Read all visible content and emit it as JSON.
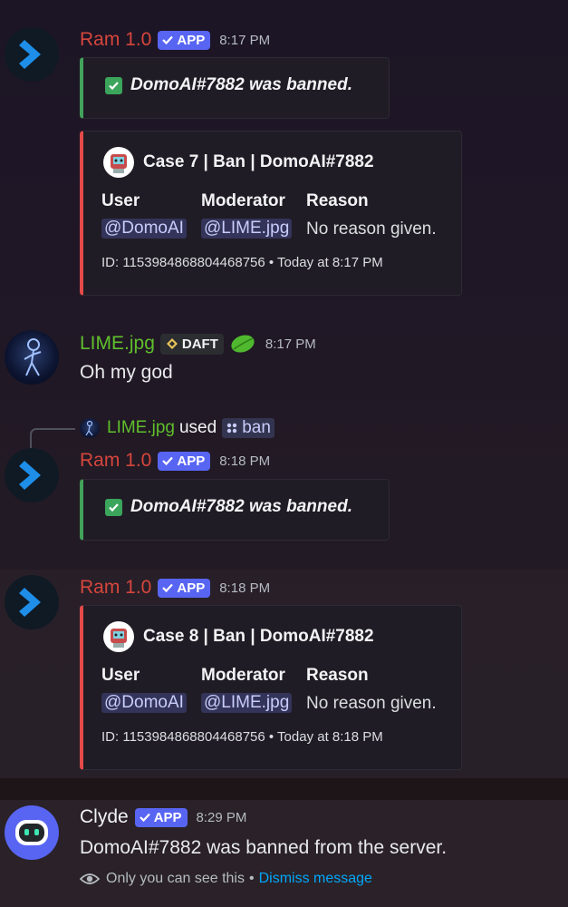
{
  "colors": {
    "ram": "#d6463c",
    "lime": "#5fbf2c",
    "embed_green": "#43a25a",
    "embed_red": "#e34a4a",
    "blurple": "#5865f2",
    "link": "#00a8fc"
  },
  "messages": [
    {
      "author": "Ram 1.0",
      "badge": "APP",
      "time": "8:17 PM",
      "ban_text": "DomoAI#7882 was banned.",
      "case": {
        "title": "Case 7 | Ban | DomoAI#7882",
        "user_label": "User",
        "moderator_label": "Moderator",
        "reason_label": "Reason",
        "user": "@DomoAI",
        "moderator": "@LIME.jpg",
        "reason": "No reason given.",
        "footer": "ID: 1153984868804468756 • Today at 8:17 PM"
      }
    },
    {
      "author": "LIME.jpg",
      "role": "DAFT",
      "time": "8:17 PM",
      "text": "Oh my god"
    },
    {
      "reply_user": "LIME.jpg",
      "reply_used": "used",
      "reply_command": "ban",
      "author": "Ram 1.0",
      "badge": "APP",
      "time": "8:18 PM",
      "ban_text": "DomoAI#7882 was banned."
    },
    {
      "author": "Ram 1.0",
      "badge": "APP",
      "time": "8:18 PM",
      "case": {
        "title": "Case 8 | Ban | DomoAI#7882",
        "user_label": "User",
        "moderator_label": "Moderator",
        "reason_label": "Reason",
        "user": "@DomoAI",
        "moderator": "@LIME.jpg",
        "reason": "No reason given.",
        "footer": "ID: 1153984868804468756 • Today at 8:18 PM"
      }
    },
    {
      "author": "Clyde",
      "badge": "APP",
      "time": "8:29 PM",
      "text": "DomoAI#7882 was banned from the server.",
      "ephemeral_note": "Only you can see this",
      "ephemeral_sep": "•",
      "dismiss": "Dismiss message"
    }
  ]
}
